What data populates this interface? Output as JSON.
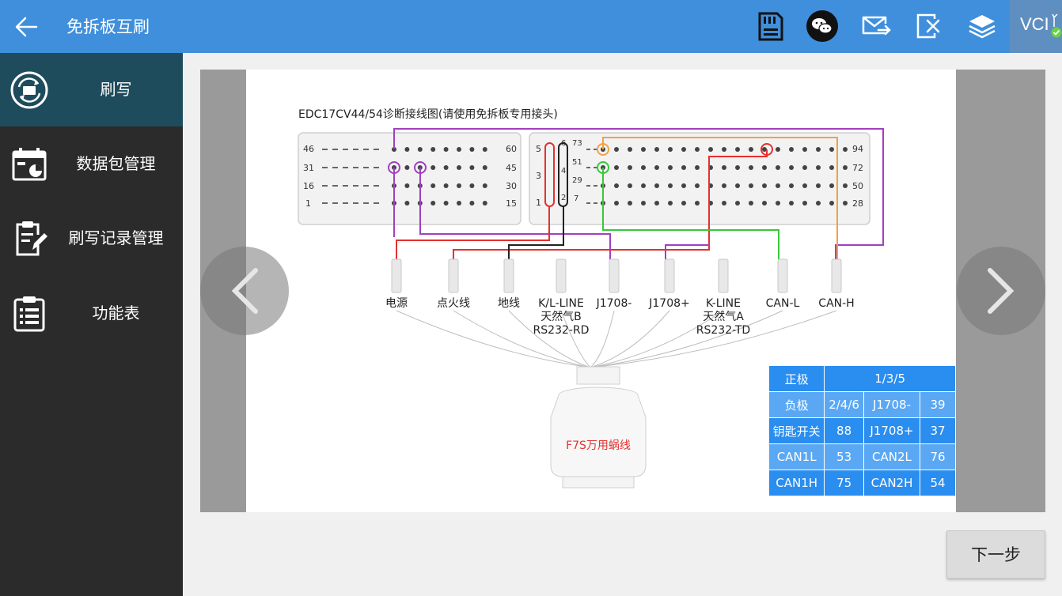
{
  "header": {
    "title": "免拆板互刷",
    "vci_label": "VCI"
  },
  "sidebar": {
    "items": [
      {
        "label": "刷写",
        "icon": "flash-cycle-icon"
      },
      {
        "label": "数据包管理",
        "icon": "calendar-chart-icon"
      },
      {
        "label": "刷写记录管理",
        "icon": "clipboard-edit-icon"
      },
      {
        "label": "功能表",
        "icon": "checklist-icon"
      }
    ]
  },
  "diagram": {
    "title": "EDC17CV44/54诊断接线图(请使用免拆板专用接头)",
    "left_block": {
      "rows": [
        [
          "46",
          "60"
        ],
        [
          "31",
          "45"
        ],
        [
          "16",
          "30"
        ],
        [
          "1",
          "15"
        ]
      ]
    },
    "right_block": {
      "left_numbers": [
        "5",
        "3",
        "1"
      ],
      "mid_numbers": [
        "6",
        "4",
        "2"
      ],
      "col2_numbers": [
        "73",
        "51",
        "29",
        "7"
      ],
      "right_numbers": [
        "94",
        "72",
        "50",
        "28"
      ]
    },
    "wires": [
      {
        "label": "电源",
        "sub": []
      },
      {
        "label": "点火线",
        "sub": []
      },
      {
        "label": "地线",
        "sub": []
      },
      {
        "label": "K/L-LINE",
        "sub": [
          "天然气B",
          "RS232-RD"
        ]
      },
      {
        "label": "J1708-",
        "sub": []
      },
      {
        "label": "J1708+",
        "sub": []
      },
      {
        "label": "K-LINE",
        "sub": [
          "天然气A",
          "RS232-TD"
        ]
      },
      {
        "label": "CAN-L",
        "sub": []
      },
      {
        "label": "CAN-H",
        "sub": []
      }
    ],
    "connector_label": "F7S万用蜗线",
    "wire_colors": {
      "red": "#e53030",
      "purple": "#a040c0",
      "black": "#222222",
      "green": "#38c838",
      "orange": "#f5a040"
    },
    "pin_table": {
      "rows": [
        {
          "c1": "正极",
          "c2": "1/3/5"
        },
        {
          "c1": "负极",
          "c2": "2/4/6",
          "c3": "J1708-",
          "c4": "39"
        },
        {
          "c1": "钥匙开关",
          "c2": "88",
          "c3": "J1708+",
          "c4": "37"
        },
        {
          "c1": "CAN1L",
          "c2": "53",
          "c3": "CAN2L",
          "c4": "76"
        },
        {
          "c1": "CAN1H",
          "c2": "75",
          "c3": "CAN2H",
          "c4": "54"
        }
      ]
    }
  },
  "footer": {
    "next_label": "下一步"
  }
}
